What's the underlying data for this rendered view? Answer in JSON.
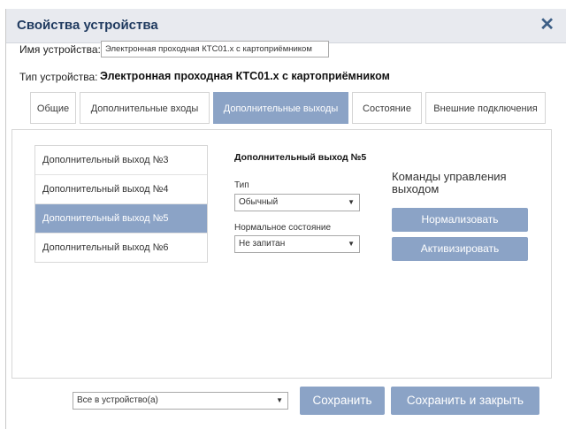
{
  "dialog": {
    "title": "Свойства устройства",
    "close_glyph": "✕"
  },
  "device": {
    "name_label": "Имя устройства:",
    "name_value": "Электронная проходная КТС01.х с картоприёмником",
    "type_label": "Тип устройства:",
    "type_value": "Электронная проходная КТС01.х с картоприёмником"
  },
  "tabs": [
    {
      "label": "Общие",
      "active": false
    },
    {
      "label": "Дополнительные входы",
      "active": false
    },
    {
      "label": "Дополнительные выходы",
      "active": true
    },
    {
      "label": "Состояние",
      "active": false
    },
    {
      "label": "Внешние подключения",
      "active": false
    }
  ],
  "outputs": {
    "items": [
      {
        "label": "Дополнительный выход №3",
        "active": false
      },
      {
        "label": "Дополнительный выход №4",
        "active": false
      },
      {
        "label": "Дополнительный выход №5",
        "active": true
      },
      {
        "label": "Дополнительный выход №6",
        "active": false
      }
    ],
    "selected_title": "Дополнительный выход №5",
    "type_label": "Тип",
    "type_value": "Обычный",
    "normal_state_label": "Нормальное состояние",
    "normal_state_value": "Не запитан"
  },
  "commands": {
    "title": "Команды управления выходом",
    "normalize_label": "Нормализовать",
    "activate_label": "Активизировать"
  },
  "footer": {
    "scope_value": "Все в устройство(а)",
    "save_label": "Сохранить",
    "save_close_label": "Сохранить и закрыть"
  },
  "colors": {
    "accent": "#8ba3c6",
    "title_text": "#1f3a5f",
    "close_icon": "#3d5f86"
  },
  "icons": {
    "close": "close-icon",
    "dropdown": "chevron-down-icon"
  }
}
